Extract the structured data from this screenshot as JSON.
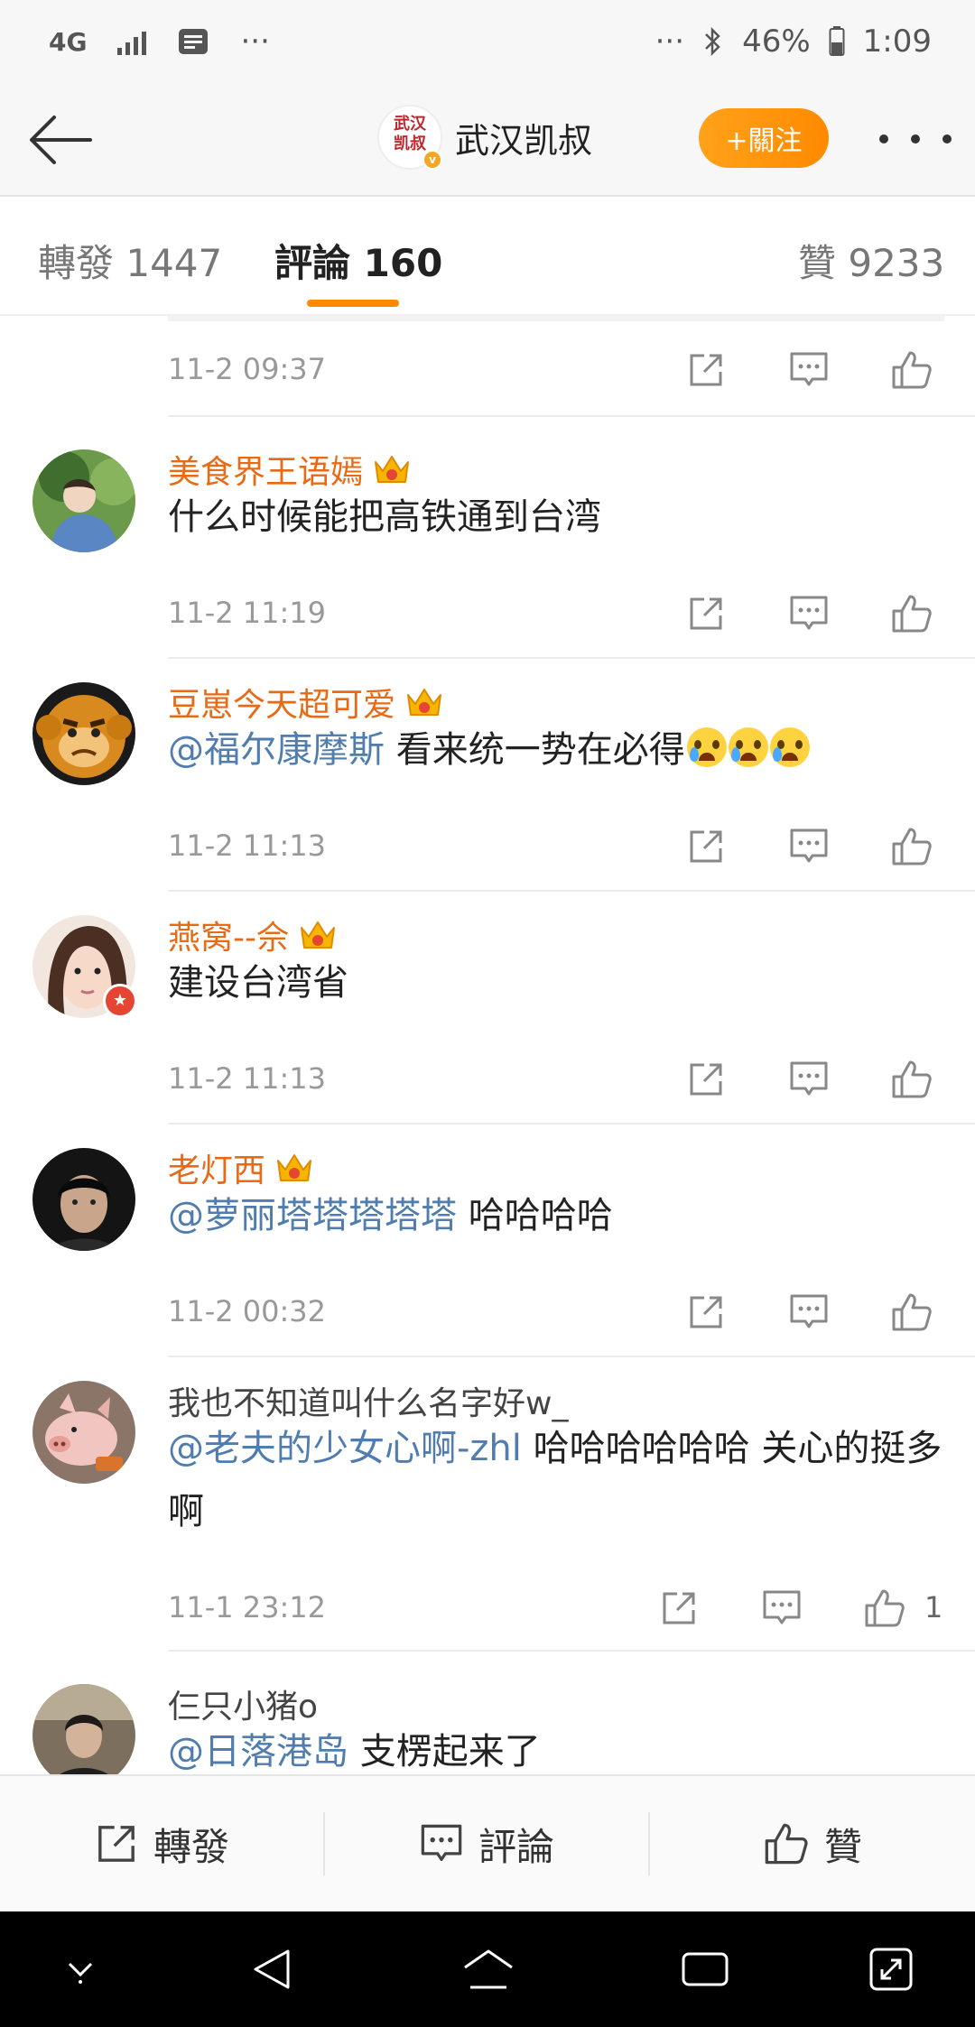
{
  "status_bar": {
    "network": "4G",
    "network_sub": "",
    "left_more": "···",
    "right_more": "···",
    "battery": "46%",
    "time": "1:09"
  },
  "header": {
    "account_name": "武汉凯叔",
    "logo_text": "武汉凯叔",
    "follow_label": "+關注"
  },
  "tabs": {
    "repost": "轉發 1447",
    "comments": "評論 160",
    "likes": "贊 9233"
  },
  "comments": [
    {
      "time": "11-2 09:37",
      "like_count": ""
    },
    {
      "user": "美食界王语嫣",
      "user_color": "#e86a14",
      "text": "什么时候能把高铁通到台湾",
      "time": "11-2 11:19",
      "like_count": ""
    },
    {
      "user": "豆崽今天超可爱",
      "user_color": "#e86a14",
      "mention": "@福尔康摩斯",
      "text": " 看来统一势在必得",
      "emoji": "crying-laugh",
      "time": "11-2 11:13",
      "like_count": ""
    },
    {
      "user": "燕窝--佘",
      "user_color": "#e86a14",
      "text": "建设台湾省",
      "time": "11-2 11:13",
      "like_count": ""
    },
    {
      "user": "老灯西",
      "user_color": "#e86a14",
      "mention": "@萝丽塔塔塔塔塔",
      "text": " 哈哈哈哈",
      "time": "11-2 00:32",
      "like_count": ""
    },
    {
      "user": "我也不知道叫什么名字好w_",
      "user_color": "#444444",
      "mention": "@老夫的少女心啊-zhl",
      "text": " 哈哈哈哈哈哈 关心的挺多啊",
      "time": "11-1 23:12",
      "like_count": "1"
    },
    {
      "user": "仨只小猪o",
      "user_color": "#444444",
      "mention": "@日落港岛",
      "text": " 支楞起来了"
    }
  ],
  "bottom_bar": {
    "repost": "轉發",
    "comment": "評論",
    "like": "贊"
  },
  "colors": {
    "accent": "#ff8a00",
    "mention": "#507dae",
    "vip_name": "#e86a14"
  }
}
